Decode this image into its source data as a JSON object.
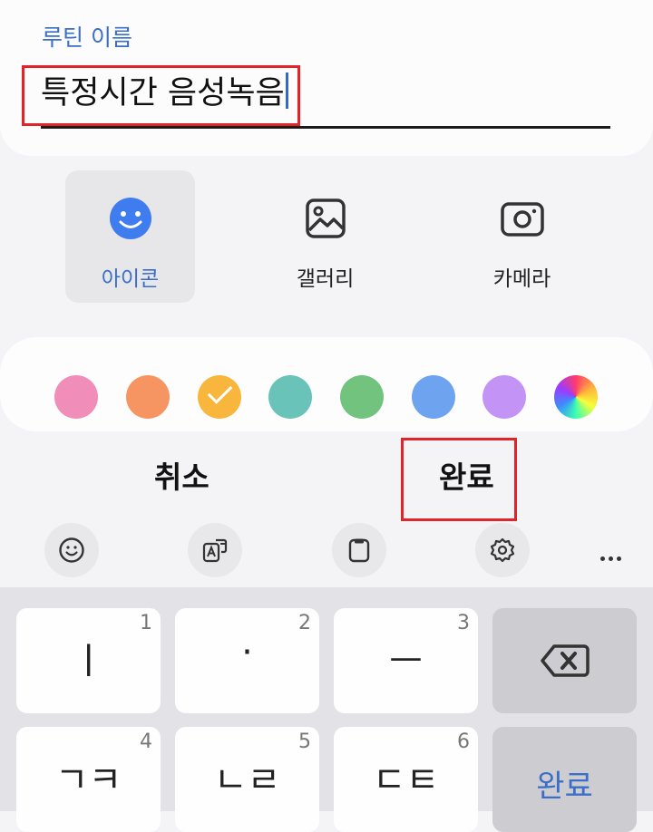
{
  "routine": {
    "label": "루틴 이름",
    "name_value": "특정시간 음성녹음"
  },
  "image_options": [
    {
      "label": "아이콘",
      "icon": "smiley-icon",
      "selected": true
    },
    {
      "label": "갤러리",
      "icon": "gallery-icon",
      "selected": false
    },
    {
      "label": "카메라",
      "icon": "camera-icon",
      "selected": false
    }
  ],
  "colors": {
    "swatches": [
      "#f08db8",
      "#f79562",
      "#f8b73c",
      "#6ac3b8",
      "#72c37e",
      "#6ea4ef",
      "#c493f6",
      "rainbow"
    ],
    "selected_index": 2
  },
  "actions": {
    "cancel": "취소",
    "done": "완료"
  },
  "toolbar": {
    "items": [
      "emoji-icon",
      "translate-icon",
      "clipboard-icon",
      "settings-icon",
      "more-icon"
    ]
  },
  "keyboard": {
    "row1": [
      {
        "main": "ㅣ",
        "num": "1"
      },
      {
        "main": "·",
        "num": "2"
      },
      {
        "main": "ㅡ",
        "num": "3"
      },
      {
        "main": "backspace-icon",
        "num": ""
      }
    ],
    "row2": [
      {
        "main": "ㄱㅋ",
        "num": "4"
      },
      {
        "main": "ㄴㄹ",
        "num": "5"
      },
      {
        "main": "ㄷㅌ",
        "num": "6"
      },
      {
        "main": "완료",
        "num": ""
      }
    ]
  },
  "theme": {
    "accent": "#3b6ec8",
    "highlight_box": "#e0252a"
  }
}
